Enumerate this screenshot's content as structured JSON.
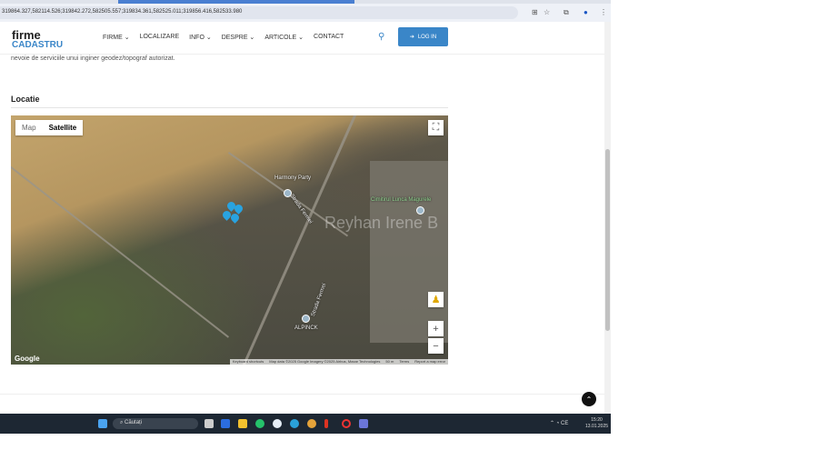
{
  "browser": {
    "url": "319864.327,582114.526;319842.272,582505.557;319834.361,582525.011;319856.416,582533.980"
  },
  "header": {
    "logo_top": "firme",
    "logo_bottom": "CADASTRU",
    "nav": [
      "FIRME ⌄",
      "LOCALIZARE",
      "INFO ⌄",
      "DESPRE ⌄",
      "ARTICOLE ⌄",
      "CONTACT"
    ],
    "login": "LOG IN"
  },
  "content": {
    "intro": "nevoie de serviciile unui inginer geodez/topograf autorizat.",
    "section_title": "Locatie"
  },
  "map": {
    "types": [
      "Map",
      "Satellite"
    ],
    "active_type": "Satellite",
    "labels": [
      "Harmony Party",
      "Strada Fermei",
      "Cimitirul Lunca Magurele",
      "ALPINCK",
      "Strada Fermei"
    ],
    "watermark": "Reyhan Irene B",
    "attribution": [
      "Keyboard shortcuts",
      "Map data ©2025 Google Imagery ©2025 Airbus, Maxar Technologies",
      "50 m",
      "Terms",
      "Report a map error"
    ],
    "google": "Google",
    "pin_color": "#29a3e0"
  },
  "taskbar": {
    "search": "Căutați",
    "clock_time": "15:20",
    "clock_date": "13.01.2025",
    "lang": "CE"
  }
}
